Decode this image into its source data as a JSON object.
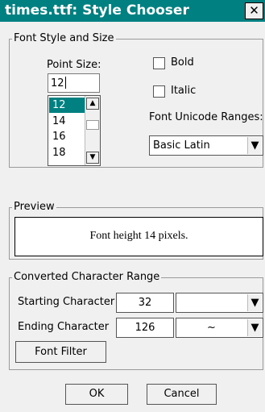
{
  "window": {
    "title": "times.ttf:  Style Chooser",
    "close_label": "✕"
  },
  "font_style_group": {
    "legend": "Font Style and Size",
    "point_size_label": "Point Size:",
    "point_size_value": "12",
    "size_list": [
      "12",
      "14",
      "16",
      "18"
    ],
    "selected_size": "12",
    "bold_label": "Bold",
    "italic_label": "Italic",
    "unicode_ranges_label": "Font Unicode Ranges:",
    "unicode_range_value": "Basic Latin"
  },
  "preview_group": {
    "legend": "Preview",
    "text": "Font height 14 pixels."
  },
  "converted_group": {
    "legend": "Converted Character Range",
    "starting_label": "Starting Character",
    "starting_value": "32",
    "starting_char": "",
    "ending_label": "Ending Character",
    "ending_value": "126",
    "ending_char": "~",
    "font_filter_label": "Font Filter"
  },
  "buttons": {
    "ok": "OK",
    "cancel": "Cancel"
  },
  "colors": {
    "titlebar": "#008080",
    "selection": "#008080"
  }
}
